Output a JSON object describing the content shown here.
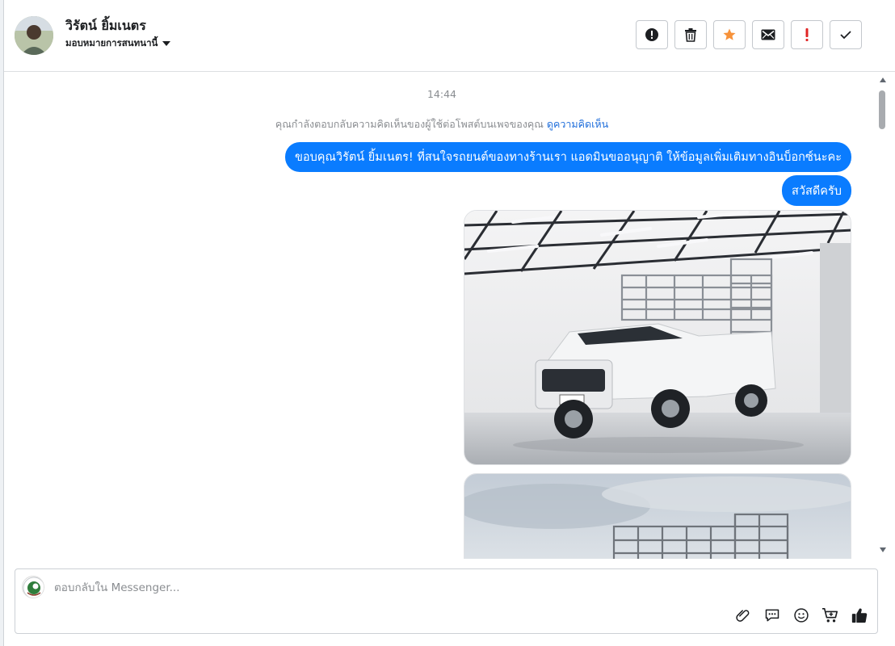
{
  "header": {
    "name": "วิรัตน์ ยิ้มเนตร",
    "assign_label": "มอบหมายการสนทนานี้",
    "actions": [
      {
        "icon": "alert-circle-icon",
        "name": "mark-spam-button"
      },
      {
        "icon": "trash-icon",
        "name": "delete-button"
      },
      {
        "icon": "star-icon",
        "name": "star-button",
        "color": "#f7923a"
      },
      {
        "icon": "envelope-icon",
        "name": "mark-unread-button"
      },
      {
        "icon": "exclamation-icon",
        "name": "follow-up-button",
        "color": "#e02424"
      },
      {
        "icon": "check-icon",
        "name": "mark-done-button"
      }
    ]
  },
  "conversation": {
    "time": "14:44",
    "context_text": "คุณกำลังตอบกลับความคิดเห็นของผู้ใช้ต่อโพสต์บนเพจของคุณ",
    "context_link": "ดูความคิดเห็น",
    "messages": [
      {
        "text": "ขอบคุณวิรัตน์ ยิ้มเนตร! ที่สนใจรถยนต์ของทางร้านเรา แอดมินขออนุญาติ ให้ข้อมูลเพิ่มเติมทางอินบ็อกซ์นะคะ"
      },
      {
        "text": "สวัสดีครับ"
      }
    ]
  },
  "composer": {
    "placeholder": "ตอบกลับใน Messenger...",
    "tools": [
      "paperclip-icon",
      "saved-replies-icon",
      "emoji-icon",
      "cart-icon",
      "thumbs-up-icon"
    ]
  },
  "colors": {
    "bubble": "#0a7cff",
    "link": "#216fdb",
    "star": "#f7923a",
    "alert": "#e02424"
  }
}
